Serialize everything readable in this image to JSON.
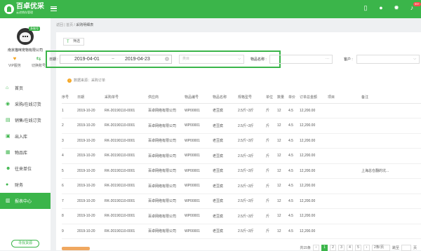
{
  "header": {
    "logo_title": "百卓优采",
    "logo_sub": "云进销存管理",
    "badge": "99+"
  },
  "sidebar": {
    "shop_name": "南京猫咪宠物有限公司",
    "vip_tag": "多账号",
    "actions": [
      {
        "label": "VIP服务"
      },
      {
        "label": "切换账号"
      }
    ],
    "items": [
      {
        "label": "首页",
        "active": false
      },
      {
        "label": "采购/在线订货",
        "active": false
      },
      {
        "label": "销售/在线订货",
        "active": false
      },
      {
        "label": "出入库",
        "active": false
      },
      {
        "label": "物品库",
        "active": false
      },
      {
        "label": "往来单位",
        "active": false
      },
      {
        "label": "财务",
        "active": false
      },
      {
        "label": "报表中心",
        "active": true
      }
    ],
    "find_button": "寻找货源"
  },
  "breadcrumb": {
    "a": "返回",
    "sep1": "|",
    "b": "首页",
    "sep2": "/",
    "c": "采购明细表"
  },
  "filter": {
    "button": "筛选",
    "date_label": "日期 :",
    "date_start": "2019-04-01",
    "date_sep": "~",
    "date_end": "2019-04-23",
    "category_placeholder": "类目",
    "item_label": "物品名称 :",
    "customer_label": "客户 :"
  },
  "datasource": "数据来源：采购订单",
  "table": {
    "headers": [
      "序号",
      "日期",
      "采购单号",
      "供应商",
      "物品编号",
      "物品名称",
      "规格型号",
      "单位",
      "数量",
      "单价",
      "订单总金额",
      "项目",
      "备注"
    ],
    "rows": [
      [
        "1",
        "2019-10-20",
        "RK-20190110-0001",
        "百卓网络有限公司",
        "WP00001",
        "老豆腐",
        "2.5斤~3斤",
        "斤",
        "12",
        "4.5",
        "12,200.00",
        "",
        ""
      ],
      [
        "2",
        "2019-10-20",
        "RK-20190110-0001",
        "百卓网络有限公司",
        "WP00001",
        "老豆腐",
        "2.5斤~3斤",
        "斤",
        "12",
        "4.5",
        "12,200.00",
        "",
        ""
      ],
      [
        "3",
        "2019-10-20",
        "RK-20190110-0001",
        "百卓网络有限公司",
        "WP00001",
        "老豆腐",
        "2.5斤~3斤",
        "斤",
        "12",
        "4.5",
        "12,200.00",
        "",
        ""
      ],
      [
        "4",
        "2019-10-20",
        "RK-20190110-0001",
        "百卓网络有限公司",
        "WP00001",
        "老豆腐",
        "2.5斤~3斤",
        "斤",
        "12",
        "4.5",
        "12,200.00",
        "",
        ""
      ],
      [
        "5",
        "2019-10-20",
        "RK-20190110-0001",
        "百卓网络有限公司",
        "WP00001",
        "老豆腐",
        "2.5斤~3斤",
        "斤",
        "12",
        "4.5",
        "12,200.00",
        "",
        "上海总仓翻的坑..."
      ],
      [
        "6",
        "2019-10-20",
        "RK-20190110-0001",
        "百卓网络有限公司",
        "WP00001",
        "老豆腐",
        "2.5斤~3斤",
        "斤",
        "12",
        "4.5",
        "12,200.00",
        "",
        ""
      ],
      [
        "7",
        "2019-10-20",
        "RK-20190110-0001",
        "百卓网络有限公司",
        "WP00001",
        "老豆腐",
        "2.5斤~3斤",
        "斤",
        "12",
        "4.5",
        "12,200.00",
        "",
        ""
      ],
      [
        "8",
        "2019-10-20",
        "RK-20190110-0001",
        "百卓网络有限公司",
        "WP00001",
        "老豆腐",
        "2.5斤~3斤",
        "斤",
        "12",
        "4.5",
        "12,200.00",
        "",
        ""
      ],
      [
        "9",
        "2019-10-20",
        "RK-20190110-0001",
        "百卓网络有限公司",
        "WP00001",
        "老豆腐",
        "2.5斤~3斤",
        "斤",
        "12",
        "4.5",
        "12,200.00",
        "",
        ""
      ]
    ]
  },
  "pager": {
    "total": "共15条",
    "pages": [
      "1",
      "2",
      "3",
      "4",
      "5"
    ],
    "per_page": "2条/页",
    "jump_label": "跳至",
    "page_unit": "页"
  },
  "colors": {
    "brand": "#3bb54a",
    "badge": "#ff4d4f"
  }
}
